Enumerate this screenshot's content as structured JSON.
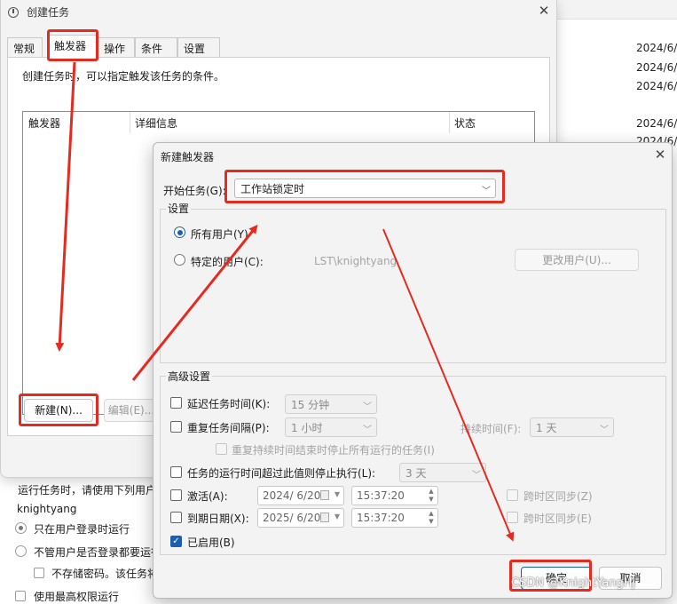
{
  "background": {
    "dates": [
      "2024/6/",
      "2024/6/",
      "2024/6/",
      "2024/6/",
      "2024/6/"
    ],
    "run_label": "运行任务时，请使用下列用户",
    "username": "knightyang",
    "radio_logged_on": "只在用户登录时运行",
    "radio_whether": "不管用户是否登录都要运行",
    "chk_no_store": "不存储密码。该任务将",
    "chk_highest": "使用最高权限运行"
  },
  "create_task": {
    "title": "创建任务",
    "tabs": [
      "常规",
      "触发器",
      "操作",
      "条件",
      "设置"
    ],
    "description": "创建任务时，可以指定触发该任务的条件。",
    "columns": [
      "触发器",
      "详细信息",
      "状态"
    ],
    "new_button": "新建(N)...",
    "edit_button": "编辑(E)..."
  },
  "new_trigger": {
    "title": "新建触发器",
    "begin_label": "开始任务(G):",
    "begin_value": "工作站锁定时",
    "settings_title": "设置",
    "all_users": "所有用户(Y)",
    "specific_user": "特定的用户(C):",
    "user_value": "LST\\knightyang",
    "change_user": "更改用户(U)...",
    "advanced_title": "高级设置",
    "delay_label": "延迟任务时间(K):",
    "delay_value": "15 分钟",
    "repeat_label": "重复任务间隔(P):",
    "repeat_value": "1 小时",
    "duration_label": "持续时间(F):",
    "duration_value": "1 天",
    "stop_repeat": "重复持续时间结束时停止所有运行的任务(I)",
    "stop_longer": "任务的运行时间超过此值则停止执行(L):",
    "stop_longer_value": "3 天",
    "activate_label": "激活(A):",
    "activate_date": "2024/ 6/20",
    "activate_time": "15:37:20",
    "expire_label": "到期日期(X):",
    "expire_date": "2025/ 6/20",
    "expire_time": "15:37:20",
    "sync_tz_1": "跨时区同步(Z)",
    "sync_tz_2": "跨时区同步(E)",
    "enabled": "已启用(B)",
    "ok": "确定",
    "cancel": "取消"
  },
  "watermark": "CSDN @KnightYangHJ",
  "colors": {
    "annotation": "#e52b20",
    "accent": "#1a5fb4"
  }
}
